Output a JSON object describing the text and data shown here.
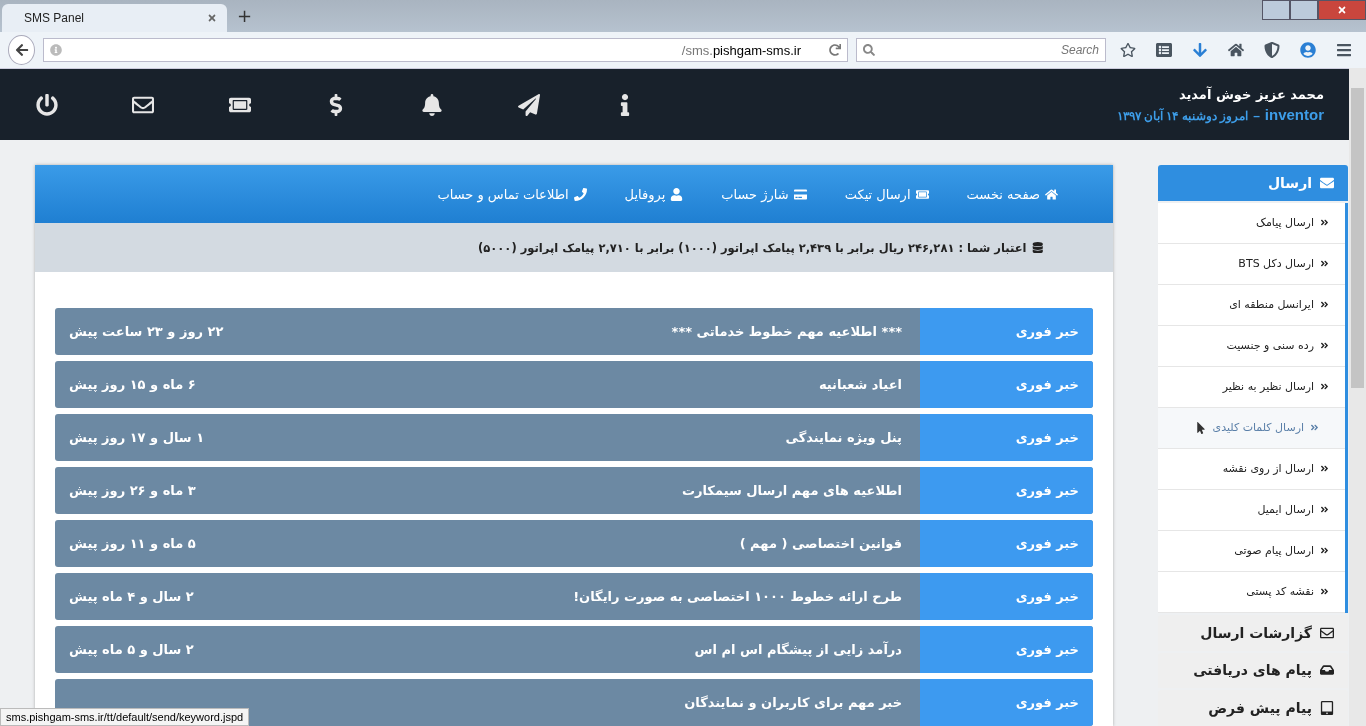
{
  "browser": {
    "tab_title": "SMS Panel",
    "new_tab": "+",
    "url_prefix": "/sms.",
    "url_host": "pishgam-sms.ir",
    "search_placeholder": "Search",
    "status_url": "sms.pishgam-sms.ir/tt/default/send/keyword.jspd"
  },
  "header": {
    "welcome": "محمد عزیز خوش آمدید",
    "username": "inventor",
    "separator": "–",
    "date": "امروز دوشنبه ۱۴ آبان ۱۳۹۷"
  },
  "top_icons": [
    {
      "kind": "info"
    },
    {
      "kind": "send"
    },
    {
      "kind": "bell"
    },
    {
      "kind": "dollar"
    },
    {
      "kind": "ticket"
    },
    {
      "kind": "mail"
    },
    {
      "kind": "power"
    }
  ],
  "nav": [
    {
      "kind": "home",
      "label": "صفحه نخست"
    },
    {
      "kind": "ticket",
      "label": "ارسال تیکت"
    },
    {
      "kind": "card",
      "label": "شارژ حساب"
    },
    {
      "kind": "user",
      "label": "پروفایل"
    },
    {
      "kind": "phone",
      "label": "اطلاعات تماس و حساب"
    }
  ],
  "credit": "اعتبار شما : ۲۴۶,۲۸۱ ریال برابر با ۲,۴۳۹ پیامک اپراتور (۱۰۰۰) برابر با ۲,۷۱۰ پیامک اپراتور (۵۰۰۰)",
  "news": [
    {
      "tag": "خبر فوری",
      "title": "*** اطلاعیه مهم خطوط خدماتی ***",
      "time": "۲۲ روز و ۲۳ ساعت پیش"
    },
    {
      "tag": "خبر فوری",
      "title": "اعیاد شعبانیه",
      "time": "۶ ماه و ۱۵ روز پیش"
    },
    {
      "tag": "خبر فوری",
      "title": "پنل ویژه نمایندگی",
      "time": "۱ سال و ۱۷ روز پیش"
    },
    {
      "tag": "خبر فوری",
      "title": "اطلاعیه های مهم ارسال سیمکارت",
      "time": "۳ ماه و ۲۶ روز پیش"
    },
    {
      "tag": "خبر فوری",
      "title": "قوانین اختصاصی ( مهم )",
      "time": "۵ ماه و ۱۱ روز پیش"
    },
    {
      "tag": "خبر فوری",
      "title": "طرح ارائه خطوط ۱۰۰۰ اختصاصی به صورت رایگان!",
      "time": "۲ سال و ۴ ماه پیش"
    },
    {
      "tag": "خبر فوری",
      "title": "درآمد زایی از پیشگام اس ام اس",
      "time": "۲ سال و ۵ ماه پیش"
    },
    {
      "tag": "خبر فوری",
      "title": "خبر مهم برای کاربران و نمایندگان"
    }
  ],
  "sidebar": [
    {
      "kind": "send",
      "label": "ارسال",
      "expanded": true,
      "items": [
        {
          "label": "ارسال پیامک",
          "highlighted": false
        },
        {
          "label": "ارسال دکل BTS",
          "highlighted": false
        },
        {
          "label": "ایرانسل منطقه ای",
          "highlighted": false
        },
        {
          "label": "رده سنی و جنسیت",
          "highlighted": false
        },
        {
          "label": "ارسال نظیر به نظیر",
          "highlighted": false
        },
        {
          "label": "ارسال کلمات کلیدی",
          "highlighted": true
        },
        {
          "label": "ارسال از روی نقشه",
          "highlighted": false
        },
        {
          "label": "ارسال ایمیل",
          "highlighted": false
        },
        {
          "label": "ارسال پیام صوتی",
          "highlighted": false
        },
        {
          "label": "نقشه کد پستی",
          "highlighted": false
        }
      ]
    },
    {
      "kind": "reports",
      "label": "گزارشات ارسال",
      "expanded": false
    },
    {
      "kind": "inbox",
      "label": "پیام های دریافتی",
      "expanded": false
    },
    {
      "kind": "mobile",
      "label": "پیام پیش فرض",
      "expanded": false
    }
  ]
}
